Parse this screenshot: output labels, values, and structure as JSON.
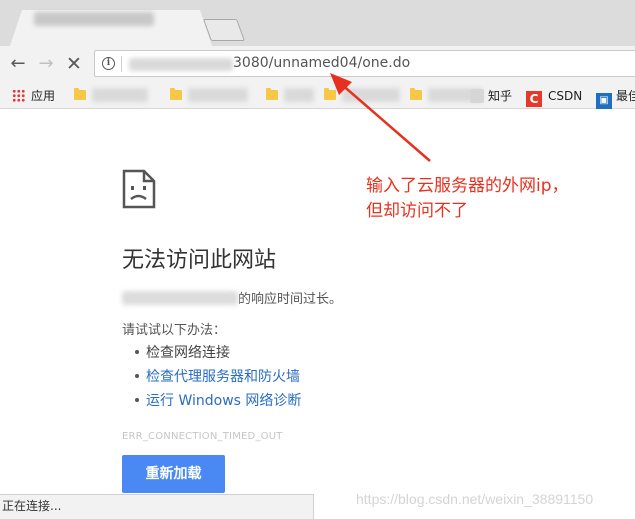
{
  "browser": {
    "tab": {
      "title": ""
    },
    "url": {
      "visible_text": "3080/unnamed04/one.do"
    },
    "bookmarks": [
      {
        "label": "应用",
        "icon": "apps-grid-icon"
      },
      {
        "label": "知乎",
        "icon": "zhihu-icon"
      },
      {
        "label": "CSDN",
        "icon": "csdn-icon",
        "icon_text": "C"
      },
      {
        "label": "最佳",
        "icon": "bookmark-icon"
      }
    ]
  },
  "error_page": {
    "title": "无法访问此网站",
    "description_suffix": "的响应时间过长。",
    "try_label": "请试试以下办法：",
    "suggestions": [
      {
        "text": "检查网络连接",
        "link": false
      },
      {
        "text": "检查代理服务器和防火墙",
        "link": true
      },
      {
        "text": "运行 Windows 网络诊断",
        "link": true
      }
    ],
    "error_code": "ERR_CONNECTION_TIMED_OUT",
    "reload_label": "重新加载"
  },
  "status_bar": {
    "text": "正在连接..."
  },
  "watermark": "https://blog.csdn.net/weixin_38891150",
  "annotation": {
    "line1": "输入了云服务器的外网ip，",
    "line2": "但却访问不了",
    "color": "#e8301f"
  },
  "colors": {
    "link": "#2a6cc4",
    "button": "#4a89f3",
    "chrome_bg": "#f2f2f2"
  }
}
